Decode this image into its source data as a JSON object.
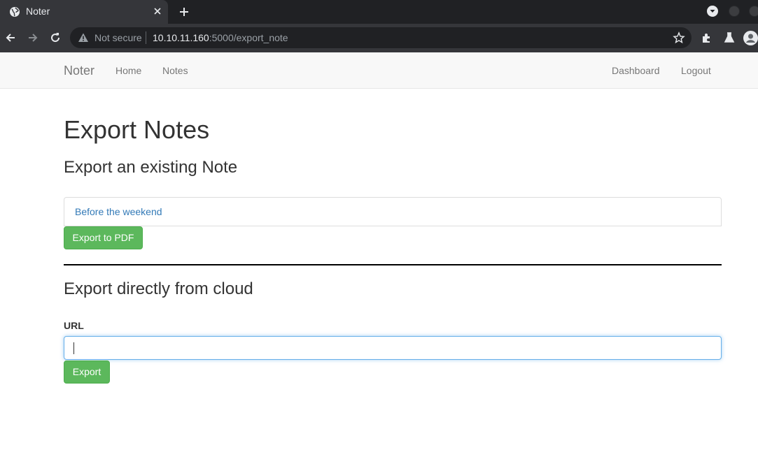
{
  "browser": {
    "tab_title": "Noter",
    "security_label": "Not secure",
    "url_host": "10.10.11.160",
    "url_rest": ":5000/export_note"
  },
  "nav": {
    "brand": "Noter",
    "links": [
      "Home",
      "Notes"
    ],
    "right_links": [
      "Dashboard",
      "Logout"
    ]
  },
  "page": {
    "title": "Export Notes",
    "section1_heading": "Export an existing Note",
    "note_item": "Before the weekend",
    "export_pdf_button": "Export to PDF",
    "section2_heading": "Export directly from cloud",
    "url_label": "URL",
    "url_value": "",
    "export_button": "Export"
  },
  "colors": {
    "button_green": "#5cb85c",
    "link_blue": "#337ab7",
    "focus_blue": "#66afe9"
  }
}
